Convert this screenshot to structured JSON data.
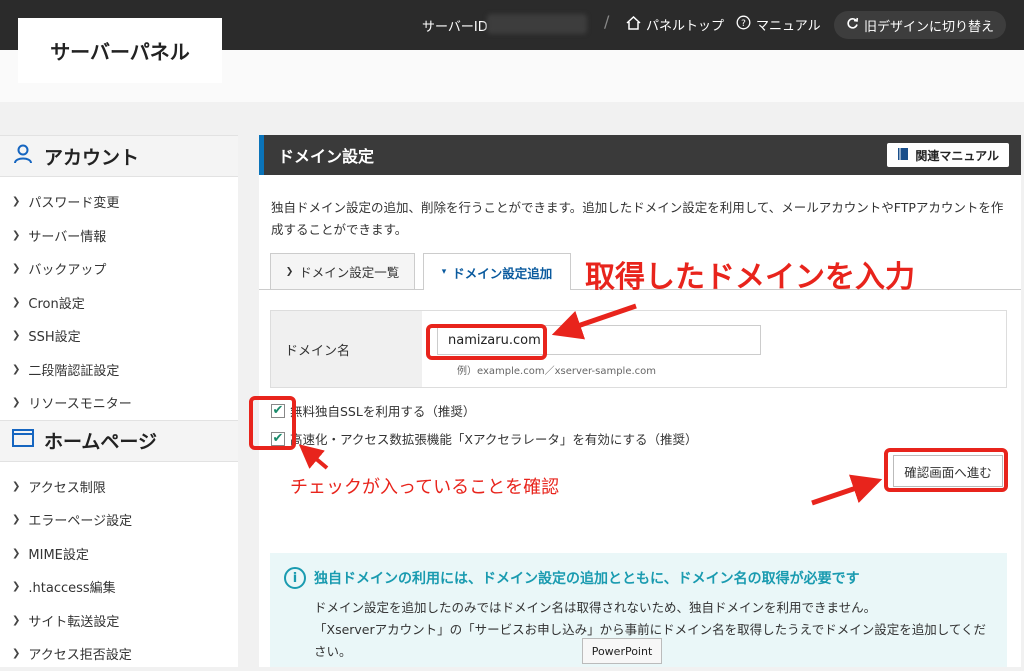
{
  "header": {
    "logo_text": "サーバーパネル",
    "server_id_label": "サーバーID",
    "separator": "/",
    "panel_top_label": "パネルトップ",
    "manual_label": "マニュアル",
    "old_design_label": "旧デザインに切り替え"
  },
  "sidebar": {
    "account_heading": "アカウント",
    "account_items": [
      "パスワード変更",
      "サーバー情報",
      "バックアップ",
      "Cron設定",
      "SSH設定",
      "二段階認証設定",
      "リソースモニター"
    ],
    "homepage_heading": "ホームページ",
    "homepage_items": [
      "アクセス制限",
      "エラーページ設定",
      "MIME設定",
      ".htaccess編集",
      "サイト転送設定",
      "アクセス拒否設定"
    ]
  },
  "main": {
    "title": "ドメイン設定",
    "related_manual_label": "関連マニュアル",
    "description": "独自ドメイン設定の追加、削除を行うことができます。追加したドメイン設定を利用して、メールアカウントやFTPアカウントを作成することができます。",
    "tabs": [
      {
        "label": "ドメイン設定一覧",
        "active": false
      },
      {
        "label": "ドメイン設定追加",
        "active": true
      }
    ],
    "form": {
      "domain_label": "ドメイン名",
      "domain_value": "namizaru.com",
      "example": "例）example.com／xserver-sample.com"
    },
    "checkboxes": [
      {
        "label": "無料独自SSLを利用する（推奨）",
        "checked": true
      },
      {
        "label": "高速化・アクセス数拡張機能「Xアクセラレータ」を有効にする（推奨）",
        "checked": true
      }
    ],
    "confirm_button": "確認画面へ進む",
    "info": {
      "title": "独自ドメインの利用には、ドメイン設定の追加とともに、ドメイン名の取得が必要です",
      "line1": "ドメイン設定を追加したのみではドメイン名は取得されないため、独自ドメインを利用できません。",
      "line2": "「Xserverアカウント」の「サービスお申し込み」から事前にドメイン名を取得したうえでドメイン設定を追加してください。"
    }
  },
  "annotations": {
    "enter_domain": "取得したドメインを入力",
    "check_confirm": "チェックが入っていることを確認",
    "color": "#e8241c"
  },
  "tooltip": "PowerPoint"
}
